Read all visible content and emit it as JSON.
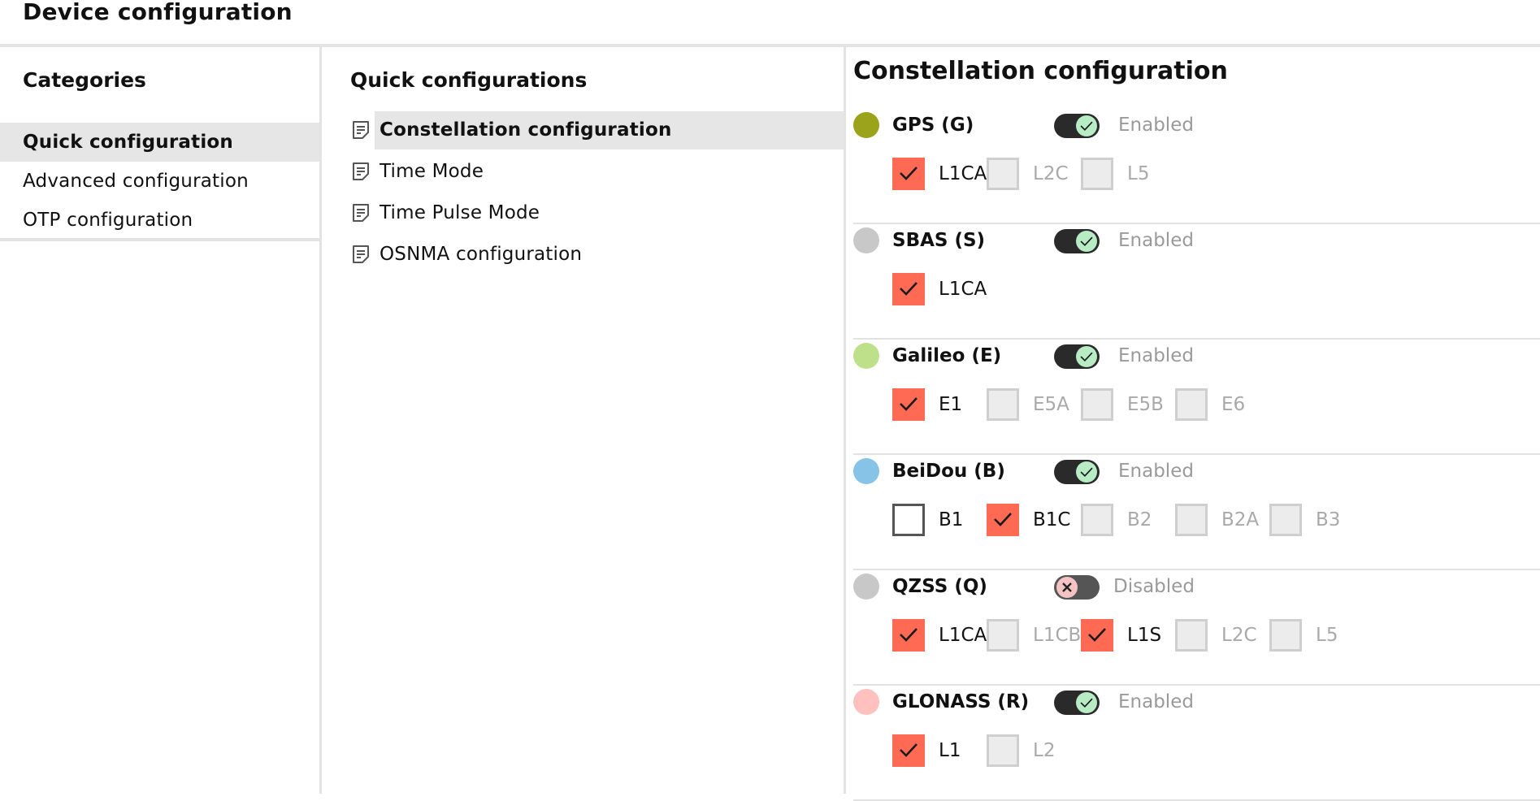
{
  "page": {
    "title": "Device configuration"
  },
  "categories": {
    "heading": "Categories",
    "items": [
      {
        "label": "Quick configuration",
        "active": true
      },
      {
        "label": "Advanced configuration",
        "active": false
      },
      {
        "label": "OTP configuration",
        "active": false
      }
    ]
  },
  "quick": {
    "heading": "Quick configurations",
    "items": [
      {
        "label": "Constellation configuration",
        "icon": "document-icon",
        "active": true
      },
      {
        "label": "Time Mode",
        "icon": "document-icon",
        "active": false
      },
      {
        "label": "Time Pulse Mode",
        "icon": "document-icon",
        "active": false
      },
      {
        "label": "OSNMA configuration",
        "icon": "document-icon",
        "active": false
      }
    ]
  },
  "constellation": {
    "title": "Constellation configuration",
    "colors": {
      "checked": "#ff6a55",
      "toggle_on_knob": "#b7ecc5",
      "toggle_off_knob": "#f4c4c4"
    },
    "items": [
      {
        "name": "GPS (G)",
        "dot_color": "#9aa31a",
        "enabled": true,
        "state_label": "Enabled",
        "signals": [
          {
            "label": "L1CA",
            "checked": true
          },
          {
            "label": "L2C",
            "checked": false
          },
          {
            "label": "L5",
            "checked": false
          }
        ]
      },
      {
        "name": "SBAS (S)",
        "dot_color": "#c8c8c8",
        "enabled": true,
        "state_label": "Enabled",
        "signals": [
          {
            "label": "L1CA",
            "checked": true
          }
        ]
      },
      {
        "name": "Galileo (E)",
        "dot_color": "#bfe08a",
        "enabled": true,
        "state_label": "Enabled",
        "signals": [
          {
            "label": "E1",
            "checked": true
          },
          {
            "label": "E5A",
            "checked": false
          },
          {
            "label": "E5B",
            "checked": false
          },
          {
            "label": "E6",
            "checked": false
          }
        ]
      },
      {
        "name": "BeiDou (B)",
        "dot_color": "#86c3e6",
        "enabled": true,
        "state_label": "Enabled",
        "signals": [
          {
            "label": "B1",
            "checked": false,
            "enabled": true
          },
          {
            "label": "B1C",
            "checked": true
          },
          {
            "label": "B2",
            "checked": false
          },
          {
            "label": "B2A",
            "checked": false
          },
          {
            "label": "B3",
            "checked": false
          }
        ]
      },
      {
        "name": "QZSS (Q)",
        "dot_color": "#c8c8c8",
        "enabled": false,
        "state_label": "Disabled",
        "signals": [
          {
            "label": "L1CA",
            "checked": true
          },
          {
            "label": "L1CB",
            "checked": false
          },
          {
            "label": "L1S",
            "checked": true
          },
          {
            "label": "L2C",
            "checked": false
          },
          {
            "label": "L5",
            "checked": false
          }
        ]
      },
      {
        "name": "GLONASS (R)",
        "dot_color": "#ffc0c0",
        "enabled": true,
        "state_label": "Enabled",
        "signals": [
          {
            "label": "L1",
            "checked": true
          },
          {
            "label": "L2",
            "checked": false
          }
        ]
      }
    ]
  }
}
